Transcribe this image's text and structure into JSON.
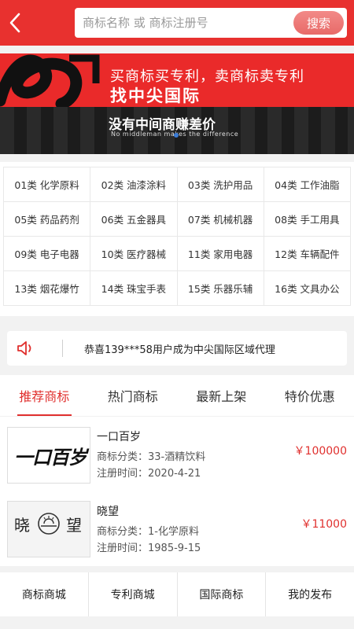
{
  "header": {
    "back_icon": "chevron-left-icon",
    "search_placeholder": "商标名称 或 商标注册号",
    "search_button": "搜索"
  },
  "banner": {
    "line1": "买商标买专利，卖商标卖专利",
    "line2": "找中尖国际",
    "slogan": "没有中间商赚差价",
    "slogan_en": "No middleman makes the difference"
  },
  "categories": [
    "01类 化学原料",
    "02类 油漆涂料",
    "03类 洗护用品",
    "04类 工作油脂",
    "05类 药品药剂",
    "06类 五金器具",
    "07类 机械机器",
    "08类 手工用具",
    "09类 电子电器",
    "10类 医疗器械",
    "11类 家用电器",
    "12类 车辆配件",
    "13类 烟花爆竹",
    "14类 珠宝手表",
    "15类 乐器乐辅",
    "16类 文具办公"
  ],
  "notice": {
    "icon": "speaker-icon",
    "text": "恭喜139***58用户成为中尖国际区域代理"
  },
  "tabs": [
    "推荐商标",
    "热门商标",
    "最新上架",
    "特价优惠"
  ],
  "active_tab": 0,
  "products": [
    {
      "logo_text": "一口百岁",
      "name": "一口百岁",
      "category_label": "商标分类：",
      "category": "33-酒精饮料",
      "date_label": "注册时间：",
      "date": "2020-4-21",
      "price": "￥100000"
    },
    {
      "logo_text_left": "晓",
      "logo_text_right": "望",
      "name": "晓望",
      "category_label": "商标分类：",
      "category": "1-化学原料",
      "date_label": "注册时间：",
      "date": "1985-9-15",
      "price": "￥11000"
    }
  ],
  "bottom_nav": [
    "商标商城",
    "专利商城",
    "国际商标",
    "我的发布"
  ],
  "colors": {
    "brand_red": "#e8312f",
    "price_red": "#e0302e"
  }
}
